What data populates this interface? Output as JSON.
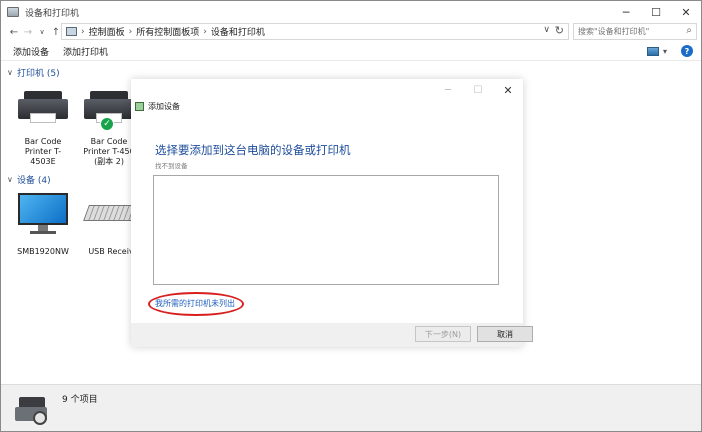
{
  "window": {
    "title": "设备和打印机"
  },
  "address": {
    "crumbs": [
      "控制面板",
      "所有控制面板项",
      "设备和打印机"
    ],
    "search_placeholder": "搜索\"设备和打印机\""
  },
  "toolbar": {
    "add_device": "添加设备",
    "add_printer": "添加打印机"
  },
  "sections": {
    "printers": "打印机 (5)",
    "devices": "设备 (4)"
  },
  "printers": [
    {
      "line1": "Bar Code",
      "line2": "Printer T-4503E",
      "line3": ""
    },
    {
      "line1": "Bar Code",
      "line2": "Printer T-450",
      "line3": "(副本 2)"
    }
  ],
  "devices": [
    {
      "label": "SMB1920NW"
    },
    {
      "label": "USB Receiv"
    }
  ],
  "status": {
    "count": "9 个项目"
  },
  "dialog": {
    "title": "添加设备",
    "heading": "选择要添加到这台电脑的设备或打印机",
    "subtext": "找不到设备",
    "link": "我所需的打印机未列出",
    "next": "下一步(N)",
    "cancel": "取消"
  },
  "colors": {
    "accent": "#1d4d9c",
    "link": "#1f5fbf",
    "highlight_ellipse": "#d81e1e",
    "check": "#16a34a"
  }
}
